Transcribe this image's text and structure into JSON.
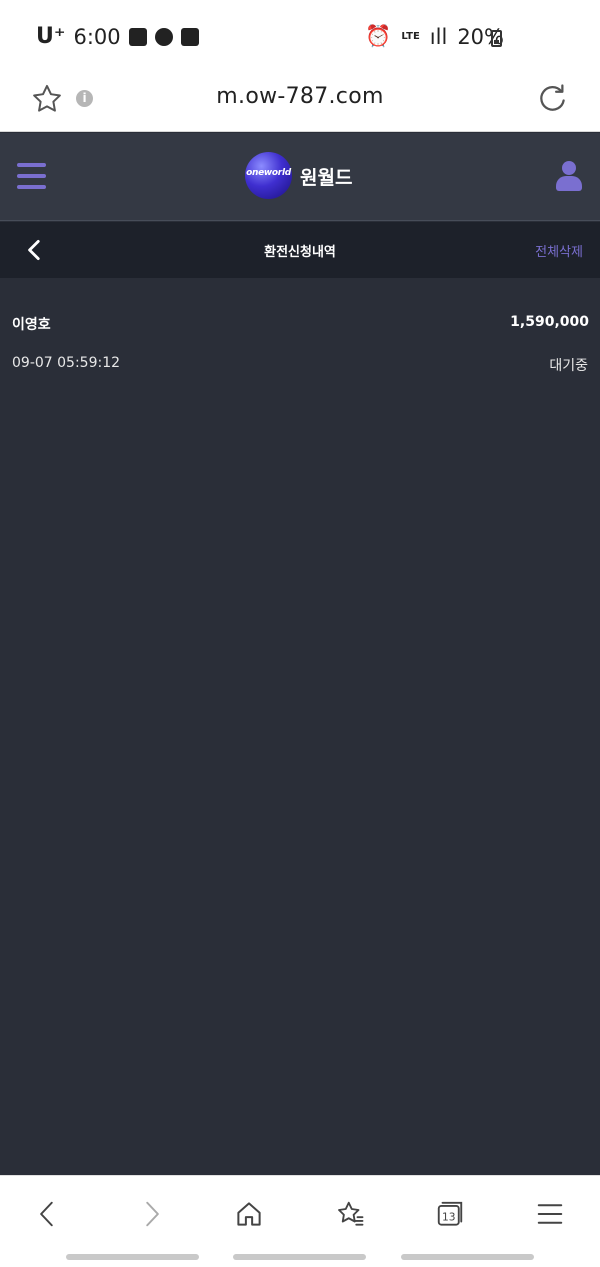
{
  "status_bar": {
    "carrier": "U⁺",
    "time": "6:00",
    "network": "LTE",
    "signal": "ıll",
    "battery": "20%"
  },
  "browser": {
    "url": "m.ow-787.com",
    "info_glyph": "i",
    "tab_count": "13"
  },
  "app": {
    "logo_mark": "oneworld",
    "logo_text": "원월드"
  },
  "sub_header": {
    "title": "환전신청내역",
    "delete_all_label": "전체삭제"
  },
  "entries": [
    {
      "name": "이영호",
      "amount": "1,590,000",
      "datetime": "09-07 05:59:12",
      "status": "대기중"
    }
  ],
  "colors": {
    "accent": "#7a6fd0",
    "header_bg": "#343944",
    "subheader_bg": "#1d212a",
    "content_bg": "#2a2e38"
  },
  "icons": {
    "nav_back": "chevron-left-icon",
    "nav_forward": "chevron-right-icon",
    "nav_home": "home-icon",
    "nav_bookmarks": "bookmark-star-icon",
    "nav_tabs": "tabs-icon",
    "nav_menu": "menu-icon"
  }
}
